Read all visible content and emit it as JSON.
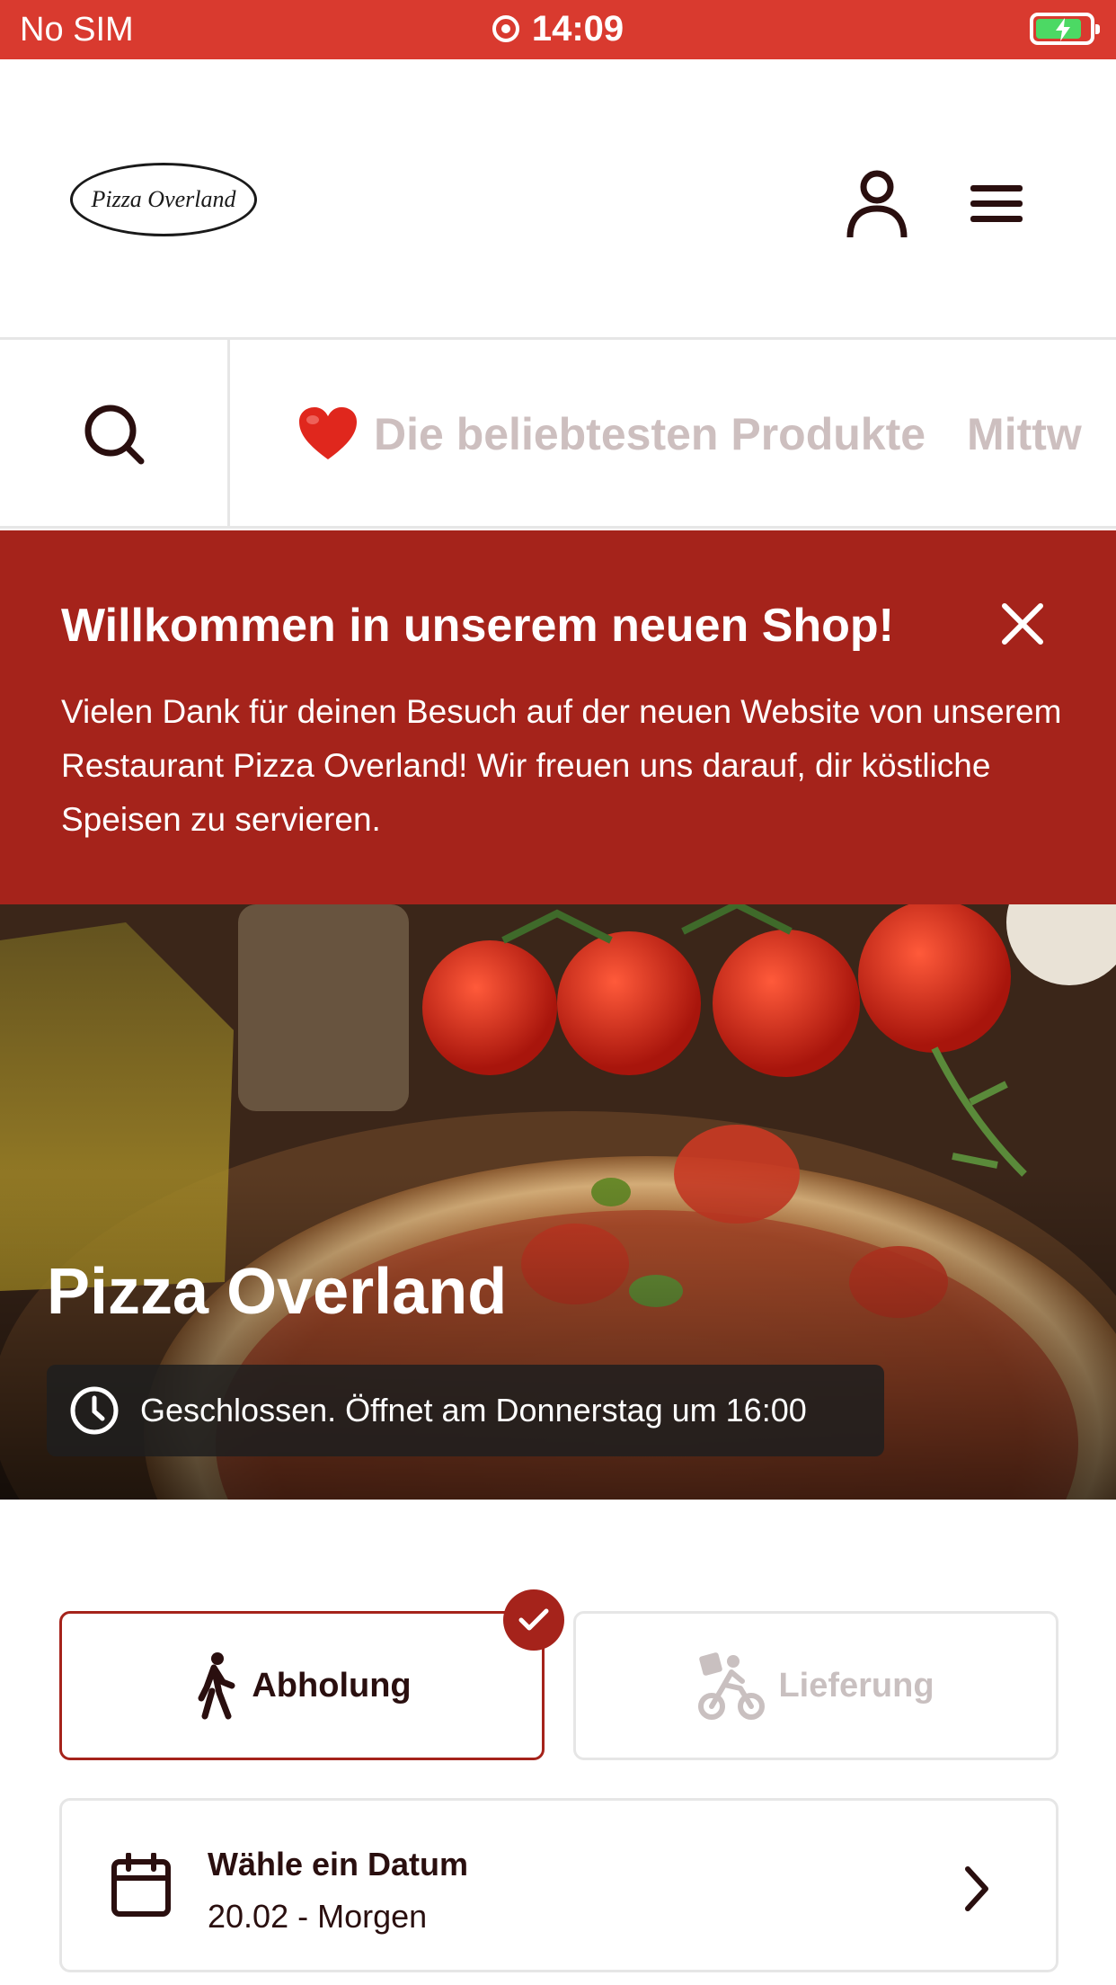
{
  "status_bar": {
    "carrier": "No SIM",
    "time": "14:09"
  },
  "header": {
    "logo_text": "Pizza Overland"
  },
  "category_bar": {
    "items": [
      {
        "label": "Die beliebtesten Produkte",
        "icon": "heart-icon"
      },
      {
        "label": "Mittw"
      }
    ]
  },
  "banner": {
    "title": "Willkommen in unserem neuen Shop!",
    "text": "Vielen Dank für deinen Besuch auf der neuen Website von unserem Restaurant Pizza Overland! Wir freuen uns darauf, dir köstliche Speisen zu servieren."
  },
  "hero": {
    "restaurant_name": "Pizza Overland",
    "hours_status": "Geschlossen. Öffnet am Donnerstag um 16:00"
  },
  "order_mode": {
    "pickup_label": "Abholung",
    "delivery_label": "Lieferung",
    "selected": "pickup"
  },
  "date_picker": {
    "label": "Wähle ein Datum",
    "value": "20.02 - Morgen"
  },
  "colors": {
    "status_bar": "#d93a2f",
    "brand_red": "#a5231b",
    "muted_text": "#cdbfbf"
  }
}
